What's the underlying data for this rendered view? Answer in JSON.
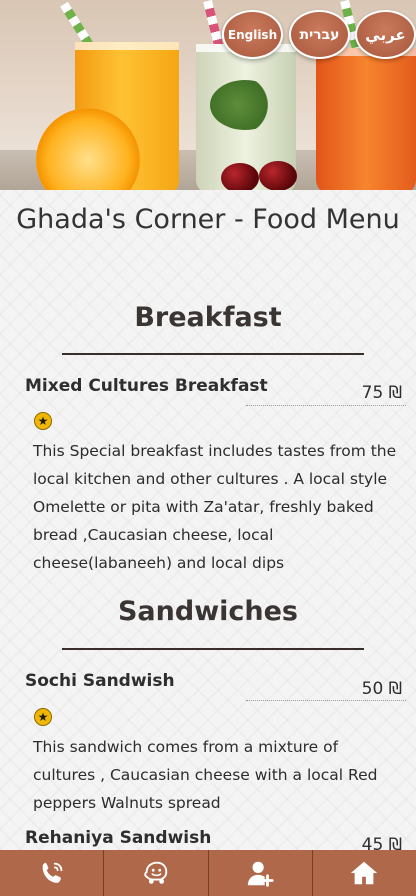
{
  "languages": {
    "english": "English",
    "hebrew": "עברית",
    "arabic": "عربي"
  },
  "page_title": "Ghada's Corner - Food Menu",
  "sections": [
    {
      "title": "Breakfast",
      "items": [
        {
          "name": "Mixed Cultures Breakfast",
          "price": "75 ₪",
          "description": "This Special breakfast includes tastes from the local kitchen and other cultures . A local style Omelette or pita with Za'atar, freshly baked bread ,Caucasian cheese, local cheese(labaneeh) and local dips"
        }
      ]
    },
    {
      "title": "Sandwiches",
      "items": [
        {
          "name": "Sochi Sandwish",
          "price": "50 ₪",
          "description": "This sandwich comes from a mixture of cultures , Caucasian cheese with a local Red peppers Walnuts spread"
        },
        {
          "name": "Rehaniya Sandwish",
          "price": "45 ₪"
        }
      ]
    }
  ],
  "bottom_nav": [
    {
      "icon": "phone-icon"
    },
    {
      "icon": "waze-icon"
    },
    {
      "icon": "add-user-icon"
    },
    {
      "icon": "home-icon"
    }
  ],
  "colors": {
    "accent": "#b0684a",
    "rule": "#3a2e2a",
    "star": "#f2b705"
  }
}
